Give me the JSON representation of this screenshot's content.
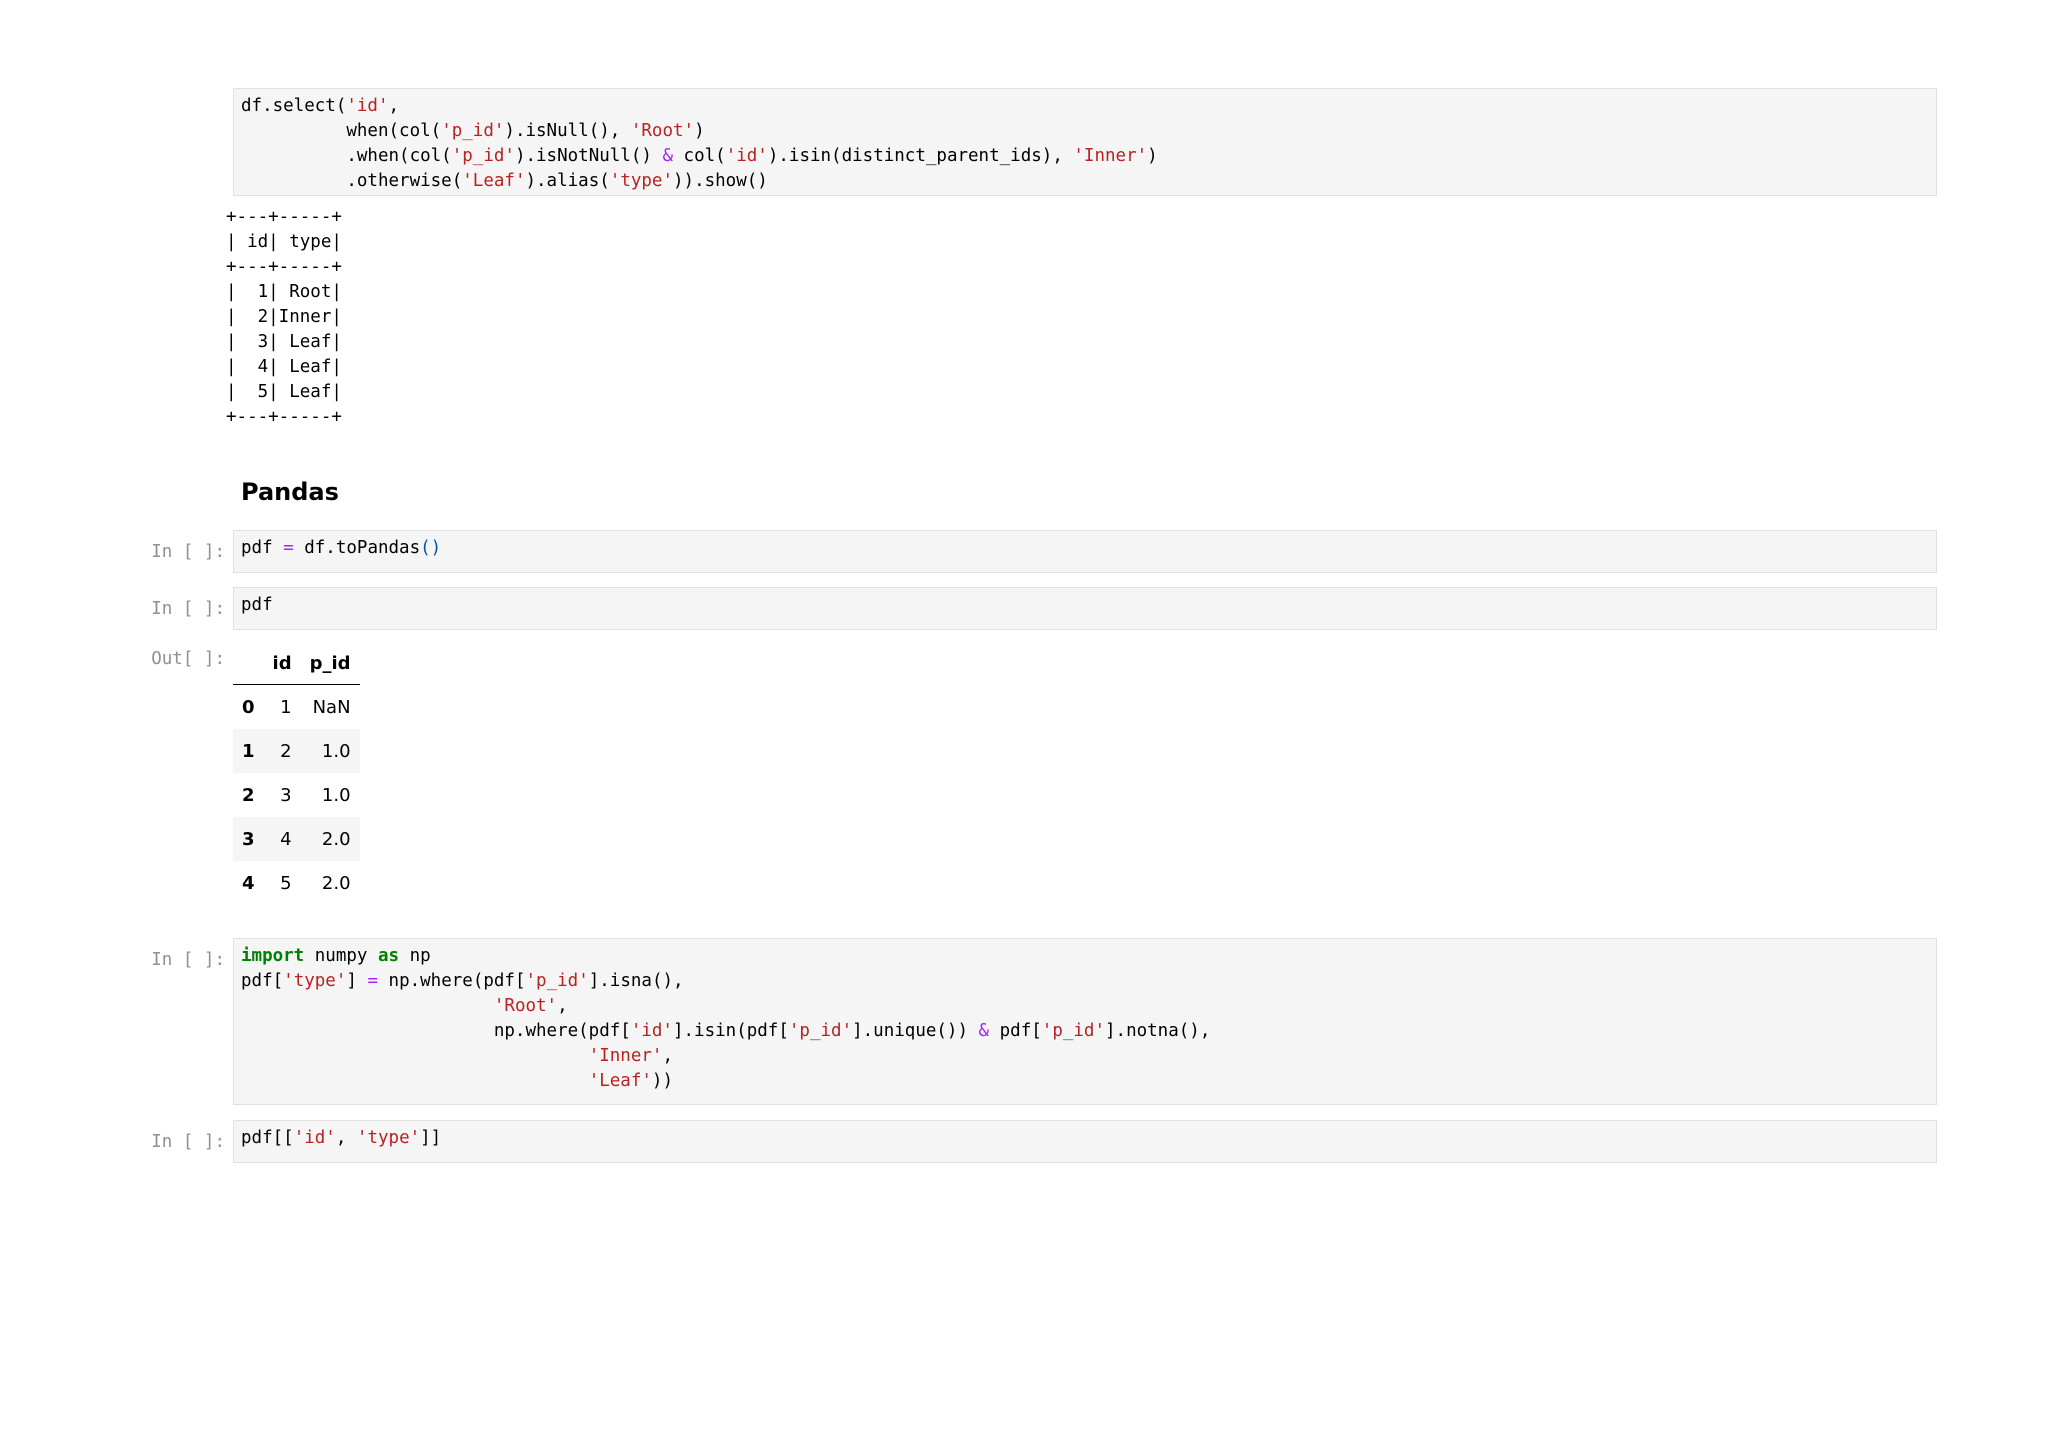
{
  "cell1": {
    "code": [
      [
        [
          "df.select(",
          "t"
        ],
        [
          "'id'",
          "s"
        ],
        [
          ",",
          "t"
        ]
      ],
      [
        [
          "          when(col(",
          "t"
        ],
        [
          "'p_id'",
          "s"
        ],
        [
          ").isNull(), ",
          "t"
        ],
        [
          "'Root'",
          "s"
        ],
        [
          ")",
          "t"
        ]
      ],
      [
        [
          "          .when(col(",
          "t"
        ],
        [
          "'p_id'",
          "s"
        ],
        [
          ").isNotNull() ",
          "t"
        ],
        [
          "&",
          "o"
        ],
        [
          " col(",
          "t"
        ],
        [
          "'id'",
          "s"
        ],
        [
          ").isin(distinct_parent_ids), ",
          "t"
        ],
        [
          "'Inner'",
          "s"
        ],
        [
          ")",
          "t"
        ]
      ],
      [
        [
          "          .otherwise(",
          "t"
        ],
        [
          "'Leaf'",
          "s"
        ],
        [
          ").alias(",
          "t"
        ],
        [
          "'type'",
          "s"
        ],
        [
          ")).show()",
          "t"
        ]
      ]
    ],
    "output": "+---+-----+\n| id| type|\n+---+-----+\n|  1| Root|\n|  2|Inner|\n|  3| Leaf|\n|  4| Leaf|\n|  5| Leaf|\n+---+-----+"
  },
  "heading": "Pandas",
  "cell2": {
    "prompt": "In [ ]:",
    "code": [
      [
        [
          "pdf ",
          "t"
        ],
        [
          "=",
          "o"
        ],
        [
          " df.toPandas",
          "t"
        ],
        [
          "()",
          "p"
        ]
      ]
    ]
  },
  "cell3": {
    "prompt": "In [ ]:",
    "code": [
      [
        [
          "pdf",
          "t"
        ]
      ]
    ],
    "out_prompt": "Out[ ]:",
    "table": {
      "columns": [
        "",
        "id",
        "p_id"
      ],
      "rows": [
        [
          "0",
          "1",
          "NaN"
        ],
        [
          "1",
          "2",
          "1.0"
        ],
        [
          "2",
          "3",
          "1.0"
        ],
        [
          "3",
          "4",
          "2.0"
        ],
        [
          "4",
          "5",
          "2.0"
        ]
      ]
    }
  },
  "cell4": {
    "prompt": "In [ ]:",
    "code": [
      [
        [
          "import",
          "k"
        ],
        [
          " numpy ",
          "t"
        ],
        [
          "as",
          "k"
        ],
        [
          " np",
          "t"
        ]
      ],
      [
        [
          "pdf[",
          "t"
        ],
        [
          "'type'",
          "s"
        ],
        [
          "] ",
          "t"
        ],
        [
          "=",
          "o"
        ],
        [
          " np.where(pdf[",
          "t"
        ],
        [
          "'p_id'",
          "s"
        ],
        [
          "].isna(),",
          "t"
        ]
      ],
      [
        [
          "                        ",
          "t"
        ],
        [
          "'Root'",
          "s"
        ],
        [
          ",",
          "t"
        ]
      ],
      [
        [
          "                        np.where(pdf[",
          "t"
        ],
        [
          "'id'",
          "s"
        ],
        [
          "].isin(pdf[",
          "t"
        ],
        [
          "'p_id'",
          "s"
        ],
        [
          "].unique()) ",
          "t"
        ],
        [
          "&",
          "o"
        ],
        [
          " pdf[",
          "t"
        ],
        [
          "'p_id'",
          "s"
        ],
        [
          "].notna(),",
          "t"
        ]
      ],
      [
        [
          "                                 ",
          "t"
        ],
        [
          "'Inner'",
          "s"
        ],
        [
          ",",
          "t"
        ]
      ],
      [
        [
          "                                 ",
          "t"
        ],
        [
          "'Leaf'",
          "s"
        ],
        [
          "))",
          "t"
        ]
      ]
    ]
  },
  "cell5": {
    "prompt": "In [ ]:",
    "code": [
      [
        [
          "pdf[[",
          "t"
        ],
        [
          "'id'",
          "s"
        ],
        [
          ", ",
          "t"
        ],
        [
          "'type'",
          "s"
        ],
        [
          "]]",
          "t"
        ]
      ]
    ]
  }
}
